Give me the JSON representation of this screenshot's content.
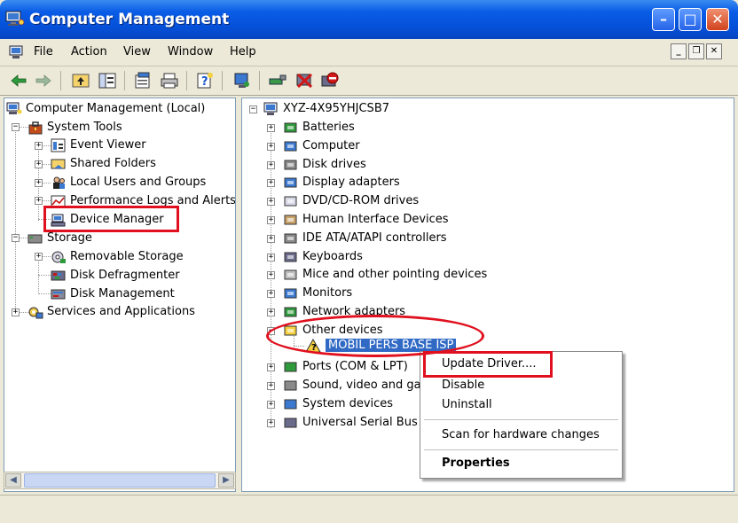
{
  "window": {
    "title": "Computer Management"
  },
  "menu": [
    "File",
    "Action",
    "View",
    "Window",
    "Help"
  ],
  "left_tree": [
    {
      "id": "root",
      "label": "Computer Management (Local)"
    },
    {
      "id": "system-tools",
      "label": "System Tools"
    },
    {
      "id": "event-viewer",
      "label": "Event Viewer"
    },
    {
      "id": "shared-folders",
      "label": "Shared Folders"
    },
    {
      "id": "local-users",
      "label": "Local Users and Groups"
    },
    {
      "id": "perf-logs",
      "label": "Performance Logs and Alerts"
    },
    {
      "id": "device-manager",
      "label": "Device Manager"
    },
    {
      "id": "storage",
      "label": "Storage"
    },
    {
      "id": "removable-storage",
      "label": "Removable Storage"
    },
    {
      "id": "disk-defrag",
      "label": "Disk Defragmenter"
    },
    {
      "id": "disk-mgmt",
      "label": "Disk Management"
    },
    {
      "id": "services-apps",
      "label": "Services and Applications"
    }
  ],
  "right_tree": {
    "root": "XYZ-4X95YHJCSB7",
    "categories": [
      "Batteries",
      "Computer",
      "Disk drives",
      "Display adapters",
      "DVD/CD-ROM drives",
      "Human Interface Devices",
      "IDE ATA/ATAPI controllers",
      "Keyboards",
      "Mice and other pointing devices",
      "Monitors",
      "Network adapters",
      "Other devices"
    ],
    "selected_device": "MOBIL PERS BASE ISP",
    "after_categories": [
      "Ports (COM & LPT)",
      "Sound, video and ga",
      "System devices",
      "Universal Serial Bus"
    ]
  },
  "context_menu": {
    "update_driver": "Update Driver....",
    "disable": "Disable",
    "uninstall": "Uninstall",
    "scan": "Scan for hardware changes",
    "properties": "Properties"
  },
  "icons": {
    "app": "computer-management-icon",
    "back": "back-arrow-icon",
    "forward": "forward-arrow-icon",
    "up": "up-folder-icon",
    "show-tree": "show-tree-icon",
    "properties": "properties-icon",
    "print": "print-icon",
    "help": "help-icon",
    "refresh": "refresh-icon",
    "scan": "scan-hardware-icon",
    "uninstall": "uninstall-icon",
    "disable": "disable-icon"
  },
  "colors": {
    "highlight": "#e0101e",
    "selection": "#316ac5",
    "titlebar": "#0550d8"
  }
}
